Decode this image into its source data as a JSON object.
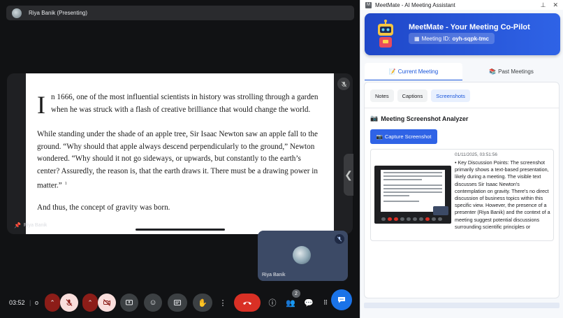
{
  "meet": {
    "presenter_label": "Riya Banik (Presenting)",
    "document": {
      "drop_cap": "I",
      "p1": "n 1666, one of the most influential scientists in history was strolling through a garden when he was struck with a flash of creative brilliance that would change the world.",
      "p2": "While standing under the shade of an apple tree, Sir Isaac Newton saw an apple fall to the ground. “Why should that apple always descend perpendicularly to the ground,” Newton wondered. “Why should it not go sideways, or upwards, but constantly to the earth’s center? Assuredly, the reason is, that the earth draws it. There must be a drawing power in matter.”",
      "p2_footnote": "1",
      "p3": "And thus, the concept of gravity was born."
    },
    "stage_name": "Riya Banik",
    "tile_name": "Riya Banik",
    "clock": "03:52",
    "separator": "|",
    "meeting_code_short": "o",
    "participants_count": "2"
  },
  "panel": {
    "window_title": "MeetMate - AI Meeting Assistant",
    "hero_title": "MeetMate - Your Meeting Co-Pilot",
    "meeting_label": "Meeting ID:",
    "meeting_id": "oyh-sqpk-tmc",
    "tabs": [
      {
        "label": "Current Meeting",
        "active": true
      },
      {
        "label": "Past Meetings",
        "active": false
      }
    ],
    "sub_tabs": [
      {
        "label": "Notes",
        "active": false
      },
      {
        "label": "Captions",
        "active": false
      },
      {
        "label": "Screenshots",
        "active": true
      }
    ],
    "section_title": "Meeting Screenshot Analyzer",
    "capture_label": "Capture Screenshot",
    "screenshot": {
      "timestamp": "01/11/2025, 03:51:56",
      "summary": "• Key Discussion Points: The screenshot primarily shows a text-based presentation, likely during a meeting. The visible text discusses Sir Isaac Newton's contemplation on gravity. There's no direct discussion of business topics within this specific view. However, the presence of a presenter (Riya Banik) and the context of a meeting suggest potential discussions surrounding scientific principles or"
    }
  },
  "colors": {
    "accent": "#2f63e6",
    "end_call": "#d93025",
    "muted_red": "#8c1d18"
  }
}
